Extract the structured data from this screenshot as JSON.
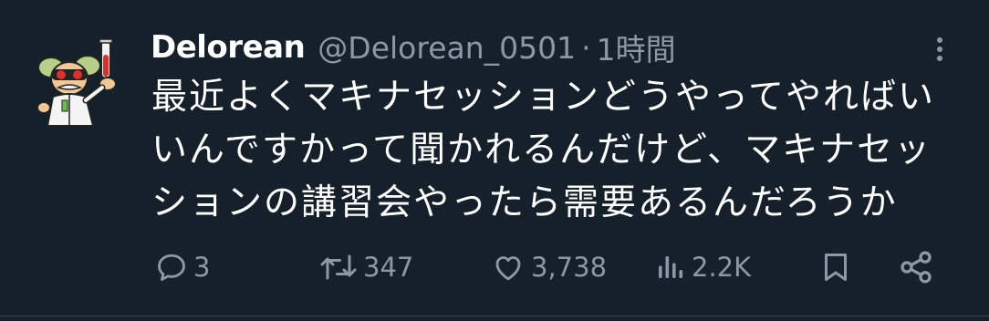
{
  "author": {
    "display_name": "Delorean",
    "handle": "@Delorean_0501",
    "separator": "·",
    "time": "1時間"
  },
  "tweet": {
    "text": "最近よくマキナセッションどうやってやればいいんですかって聞かれるんだけど、マキナセッションの講習会やったら需要あるんだろうか"
  },
  "actions": {
    "reply_count": "3",
    "retweet_count": "347",
    "like_count": "3,738",
    "views_count": "2.2K"
  },
  "colors": {
    "background": "#15202b",
    "text_primary": "#ffffff",
    "text_secondary": "#8b98a5"
  },
  "icons": {
    "more": "more-dots-icon",
    "reply": "reply-icon",
    "retweet": "retweet-icon",
    "like": "heart-icon",
    "views": "views-bar-icon",
    "bookmark": "bookmark-icon",
    "share": "share-icon"
  }
}
